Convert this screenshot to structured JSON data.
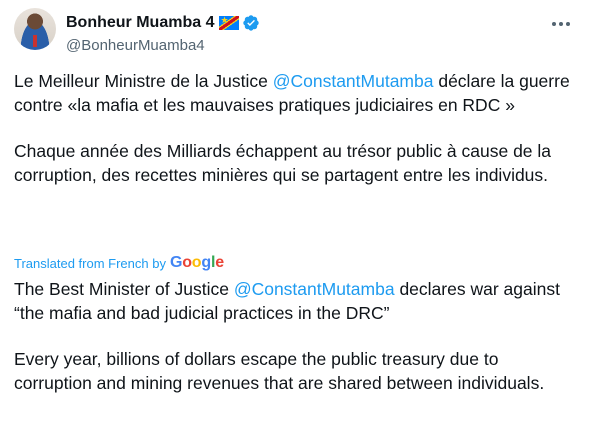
{
  "author": {
    "name": "Bonheur Muamba 4",
    "handle": "@BonheurMuamba4",
    "flag_icon": "drc-flag-icon",
    "verified_icon": "verified-badge-icon",
    "verified_color": "#1d9bf0"
  },
  "tweet": {
    "para1_before": "Le Meilleur Ministre de la Justice ",
    "para1_mention": "@ConstantMutamba",
    "para1_after": " déclare la guerre contre «la mafia et les mauvaises pratiques judiciaires en RDC »",
    "para2": "Chaque année des Milliards échappent au trésor public à cause de la corruption, des recettes minières qui se partagent entre les individus."
  },
  "translation_label": {
    "text": "Translated from French by",
    "google": "Google"
  },
  "translation": {
    "para1_before": "The Best Minister of Justice ",
    "para1_mention": "@ConstantMutamba",
    "para1_after": " declares war against “the mafia and bad judicial practices in the DRC”",
    "para2": "Every year, billions of dollars escape the public treasury due to corruption and mining revenues that are shared between individuals."
  },
  "colors": {
    "text": "#0f1419",
    "secondary": "#536471",
    "link": "#1d9bf0"
  }
}
